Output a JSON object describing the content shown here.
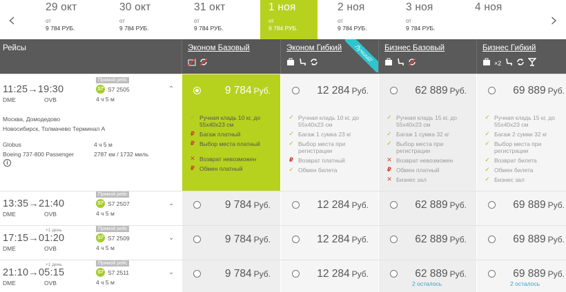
{
  "dates": [
    {
      "day": "29 окт",
      "from": "от",
      "price": "9 784",
      "cur": "РУБ."
    },
    {
      "day": "30 окт",
      "from": "от",
      "price": "9 784",
      "cur": "РУБ."
    },
    {
      "day": "31 окт",
      "from": "от",
      "price": "9 784",
      "cur": "РУБ."
    },
    {
      "day": "1 ноя",
      "from": "от",
      "price": "9 784",
      "cur": "РУБ."
    },
    {
      "day": "2 ноя",
      "from": "от",
      "price": "9 784",
      "cur": "РУБ."
    },
    {
      "day": "3 ноя",
      "from": "от",
      "price": "9 784",
      "cur": "РУБ."
    },
    {
      "day": "4 ноя",
      "from": "",
      "price": "",
      "cur": ""
    }
  ],
  "nav": {
    "prev": "‹",
    "next": "›"
  },
  "header": {
    "flights": "Рейсы",
    "fares": [
      {
        "title": "Эконом Базовый",
        "icons": [
          "no-bag-icon",
          "no-exchange-icon"
        ]
      },
      {
        "title": "Эконом Гибкий",
        "icons": [
          "bag-icon",
          "seat-icon",
          "exchange-icon"
        ],
        "badge": "Лучший!"
      },
      {
        "title": "Бизнес Базовый",
        "icons": [
          "bag-icon",
          "seat-icon",
          "no-exchange-icon"
        ]
      },
      {
        "title": "Бизнес Гибкий",
        "icons": [
          "bag-icon",
          "seat-icon",
          "exchange-icon",
          "lounge-icon"
        ],
        "multiplier": "×2"
      }
    ]
  },
  "flights": [
    {
      "dep": "11:25",
      "arr": "19:30",
      "arrow": "→",
      "from": "DME",
      "to": "OVB",
      "direct": "Прямой рейс",
      "carrier": "S7",
      "number": "S7 2505",
      "duration": "4 ч 5 м",
      "next_day": "",
      "prices": [
        {
          "v": "9 784",
          "c": "Руб."
        },
        {
          "v": "12 284",
          "c": "Руб."
        },
        {
          "v": "62 889",
          "c": "Руб."
        },
        {
          "v": "69 889",
          "c": "Руб."
        }
      ],
      "seats_left": [
        "",
        "",
        "",
        ""
      ],
      "chevron": "⌃"
    },
    {
      "dep": "13:35",
      "arr": "21:40",
      "arrow": "→",
      "from": "DME",
      "to": "OVB",
      "direct": "Прямой рейс",
      "carrier": "S7",
      "number": "S7 2507",
      "duration": "4 ч 5 м",
      "next_day": "",
      "prices": [
        {
          "v": "9 784",
          "c": "Руб."
        },
        {
          "v": "12 284",
          "c": "Руб."
        },
        {
          "v": "62 889",
          "c": "Руб."
        },
        {
          "v": "69 889",
          "c": "Руб."
        }
      ],
      "seats_left": [
        "",
        "",
        "",
        ""
      ],
      "chevron": "⌄"
    },
    {
      "dep": "17:15",
      "arr": "01:20",
      "arrow": "→",
      "from": "DME",
      "to": "OVB",
      "direct": "Прямой рейс",
      "carrier": "S7",
      "number": "S7 2509",
      "duration": "4 ч 5 м",
      "next_day": "+1 день",
      "prices": [
        {
          "v": "9 784",
          "c": "Руб."
        },
        {
          "v": "12 284",
          "c": "Руб."
        },
        {
          "v": "62 889",
          "c": "Руб."
        },
        {
          "v": "69 889",
          "c": "Руб."
        }
      ],
      "seats_left": [
        "",
        "",
        "",
        ""
      ],
      "chevron": "⌄"
    },
    {
      "dep": "21:10",
      "arr": "05:15",
      "arrow": "→",
      "from": "DME",
      "to": "OVB",
      "direct": "Прямой рейс",
      "carrier": "S7",
      "number": "S7 2511",
      "duration": "4 ч 5 м",
      "next_day": "+1 день",
      "prices": [
        {
          "v": "9 784",
          "c": "Руб."
        },
        {
          "v": "12 284",
          "c": "Руб."
        },
        {
          "v": "62 889",
          "c": "Руб."
        },
        {
          "v": "69 889",
          "c": "Руб."
        }
      ],
      "seats_left": [
        "",
        "",
        "2 осталось",
        "2 осталось"
      ],
      "chevron": "⌄"
    }
  ],
  "details": {
    "dep_airport": "Москва, Домодедово",
    "arr_airport": "Новосибирск, Толмачево Терминал А",
    "operator": "Globus",
    "aircraft": "Boeing 737-800 Passenger",
    "duration": "4 ч 5 м",
    "distance": "2787 км / 1732 миль",
    "info": "i"
  },
  "features": [
    [
      {
        "k": "ok",
        "t": "Ручная кладь 10 кг, до 55x40x23 см"
      },
      {
        "k": "paid",
        "t": "Багаж платный"
      },
      {
        "k": "paid",
        "t": "Выбор места платный"
      },
      {
        "k": "gap"
      },
      {
        "k": "no",
        "t": "Возврат невозможен"
      },
      {
        "k": "paid",
        "t": "Обмен платный"
      }
    ],
    [
      {
        "k": "ok",
        "t": "Ручная кладь 10 кг, до 55x40x23 см"
      },
      {
        "k": "ok",
        "t": "Багаж 1 сумка 23 кг"
      },
      {
        "k": "ok",
        "t": "Выбор места при регистрации"
      },
      {
        "k": "paid",
        "t": "Возврат платный"
      },
      {
        "k": "ok",
        "t": "Обмен билета"
      }
    ],
    [
      {
        "k": "ok",
        "t": "Ручная кладь 15 кг, до 55x40x23 см"
      },
      {
        "k": "ok",
        "t": "Багаж 1 сумка 32 кг"
      },
      {
        "k": "ok",
        "t": "Выбор места при регистрации"
      },
      {
        "k": "no",
        "t": "Возврат невозможен"
      },
      {
        "k": "paid",
        "t": "Обмен платный"
      },
      {
        "k": "no",
        "t": "Бизнес зал"
      }
    ],
    [
      {
        "k": "ok",
        "t": "Ручная кладь 15 кг, до 55x40x23 см"
      },
      {
        "k": "ok",
        "t": "Багаж 2 сумки 32 кг"
      },
      {
        "k": "ok",
        "t": "Выбор места при регистрации"
      },
      {
        "k": "ok",
        "t": "Возврат билета"
      },
      {
        "k": "ok",
        "t": "Обмен билета"
      },
      {
        "k": "ok",
        "t": "Бизнес зал"
      }
    ]
  ],
  "colors": {
    "accent": "#b6d21f",
    "header": "#5a5a5a",
    "ribbon": "#2ec5ce",
    "ok": "#9cc12a",
    "bad": "#d0453a"
  }
}
